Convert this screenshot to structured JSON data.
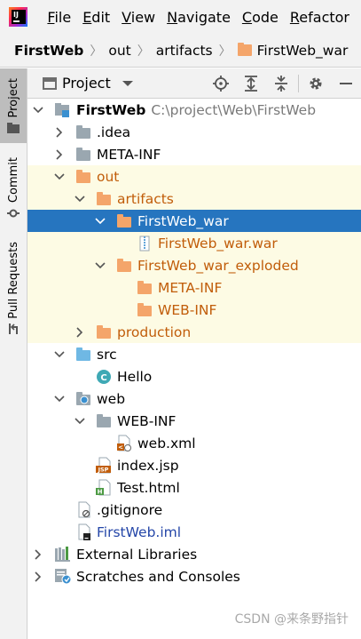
{
  "menubar": {
    "items": [
      "File",
      "Edit",
      "View",
      "Navigate",
      "Code",
      "Refactor"
    ],
    "mnemonics": [
      "F",
      "E",
      "V",
      "N",
      "C",
      "R"
    ]
  },
  "breadcrumb": {
    "items": [
      "FirstWeb",
      "out",
      "artifacts",
      "FirstWeb_war"
    ]
  },
  "toolstrip": {
    "tabs": [
      "Project",
      "Commit",
      "Pull Requests"
    ]
  },
  "project_panel": {
    "title": "Project",
    "header_icons": [
      "crosshair-icon",
      "expand-all-icon",
      "collapse-all-icon",
      "settings-icon",
      "minimize-icon"
    ]
  },
  "tree": {
    "rows": [
      {
        "label": "FirstWeb",
        "path": "C:\\project\\Web\\FirstWeb",
        "icon": "module-icon",
        "expanded": true
      },
      {
        "label": ".idea",
        "icon": "folder-gray-icon",
        "expanded": false
      },
      {
        "label": "META-INF",
        "icon": "folder-gray-icon",
        "expanded": false
      },
      {
        "label": "out",
        "icon": "folder-orange-icon",
        "expanded": true
      },
      {
        "label": "artifacts",
        "icon": "folder-orange-icon",
        "expanded": true
      },
      {
        "label": "FirstWeb_war",
        "icon": "folder-orange-icon",
        "expanded": true,
        "selected": true
      },
      {
        "label": "FirstWeb_war.war",
        "icon": "archive-icon"
      },
      {
        "label": "FirstWeb_war_exploded",
        "icon": "folder-orange-icon",
        "expanded": true
      },
      {
        "label": "META-INF",
        "icon": "folder-orange-icon"
      },
      {
        "label": "WEB-INF",
        "icon": "folder-orange-icon"
      },
      {
        "label": "production",
        "icon": "folder-orange-icon",
        "expanded": false
      },
      {
        "label": "src",
        "icon": "folder-blue-icon",
        "expanded": true
      },
      {
        "label": "Hello",
        "icon": "class-icon"
      },
      {
        "label": "web",
        "icon": "web-folder-icon",
        "expanded": true
      },
      {
        "label": "WEB-INF",
        "icon": "folder-gray-icon",
        "expanded": true
      },
      {
        "label": "web.xml",
        "icon": "xml-file-icon"
      },
      {
        "label": "index.jsp",
        "icon": "jsp-file-icon"
      },
      {
        "label": "Test.html",
        "icon": "html-file-icon"
      },
      {
        "label": ".gitignore",
        "icon": "gitignore-file-icon"
      },
      {
        "label": "FirstWeb.iml",
        "icon": "iml-file-icon"
      },
      {
        "label": "External Libraries",
        "icon": "libraries-icon",
        "expanded": false
      },
      {
        "label": "Scratches and Consoles",
        "icon": "scratches-icon",
        "expanded": false
      }
    ]
  },
  "watermark": "CSDN @来条野指针",
  "colors": {
    "selection": "#2675bf",
    "excluded_highlight": "#fdfbe4",
    "orange_folder": "#f4a56a",
    "gray_folder": "#9aa7b0",
    "blue_folder": "#6fb8e4"
  }
}
